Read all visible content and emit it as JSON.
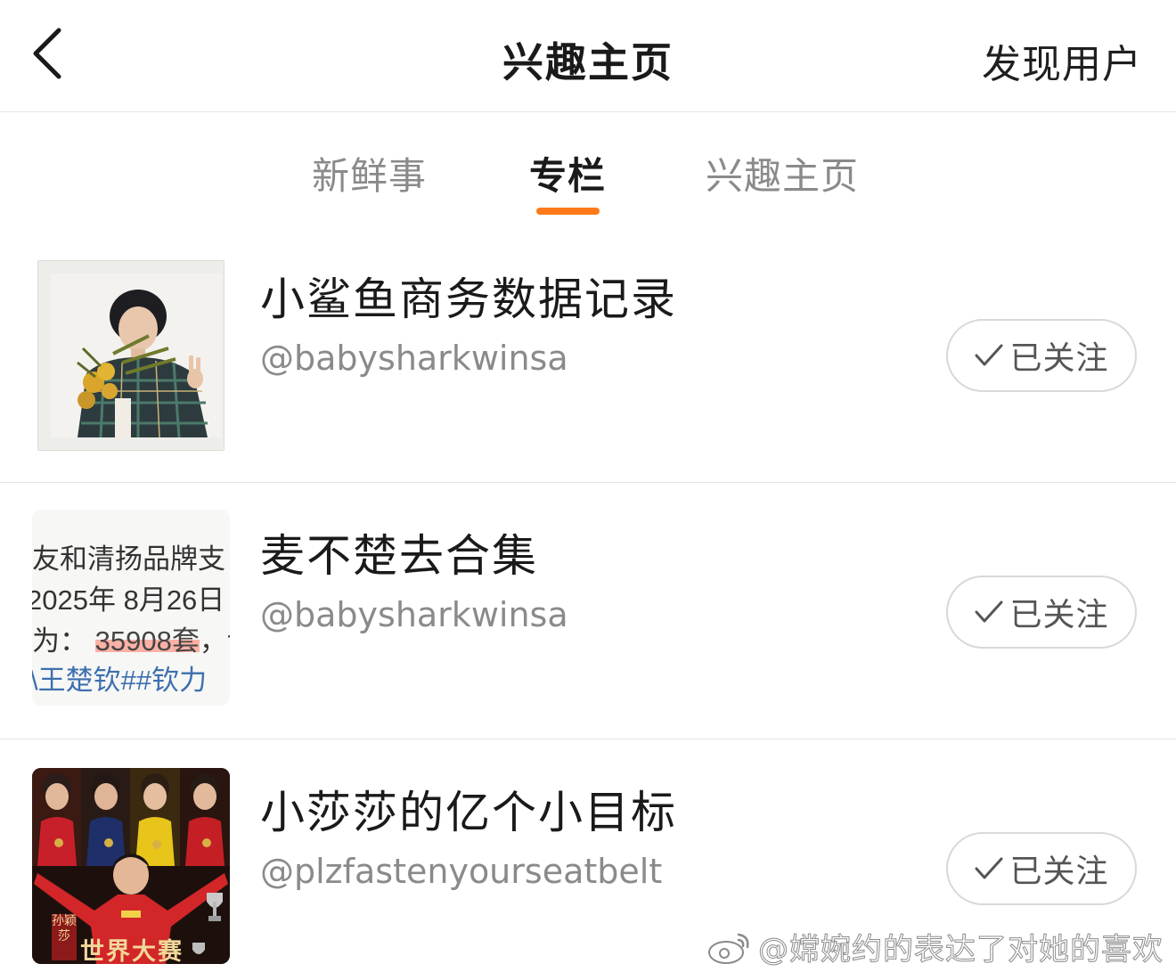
{
  "header": {
    "title": "兴趣主页",
    "right_action": "发现用户"
  },
  "tabs": [
    {
      "label": "新鲜事",
      "active": false
    },
    {
      "label": "专栏",
      "active": true
    },
    {
      "label": "兴趣主页",
      "active": false
    }
  ],
  "accent_color": "#ff7a1a",
  "items": [
    {
      "title": "小鲨鱼商务数据记录",
      "handle": "@babysharkwinsa",
      "follow_label": "已关注",
      "thumbnail": "polaroid-photo"
    },
    {
      "title": "麦不楚去合集",
      "handle": "@babysharkwinsa",
      "follow_label": "已关注",
      "thumbnail": "text-screenshot",
      "thumb_lines": [
        "友和清扬品牌支",
        "2025年 8月26日",
        "为：",
        "35908套",
        "，讠",
        "\\王楚钦##钦力"
      ]
    },
    {
      "title": "小莎莎的亿个小目标",
      "handle": "@plzfastenyourseatbelt",
      "follow_label": "已关注",
      "thumbnail": "poster",
      "thumb_badge": "孙颖莎",
      "thumb_caption": "世界大赛"
    }
  ],
  "watermark": "@嫦婉约的表达了对她的喜欢"
}
